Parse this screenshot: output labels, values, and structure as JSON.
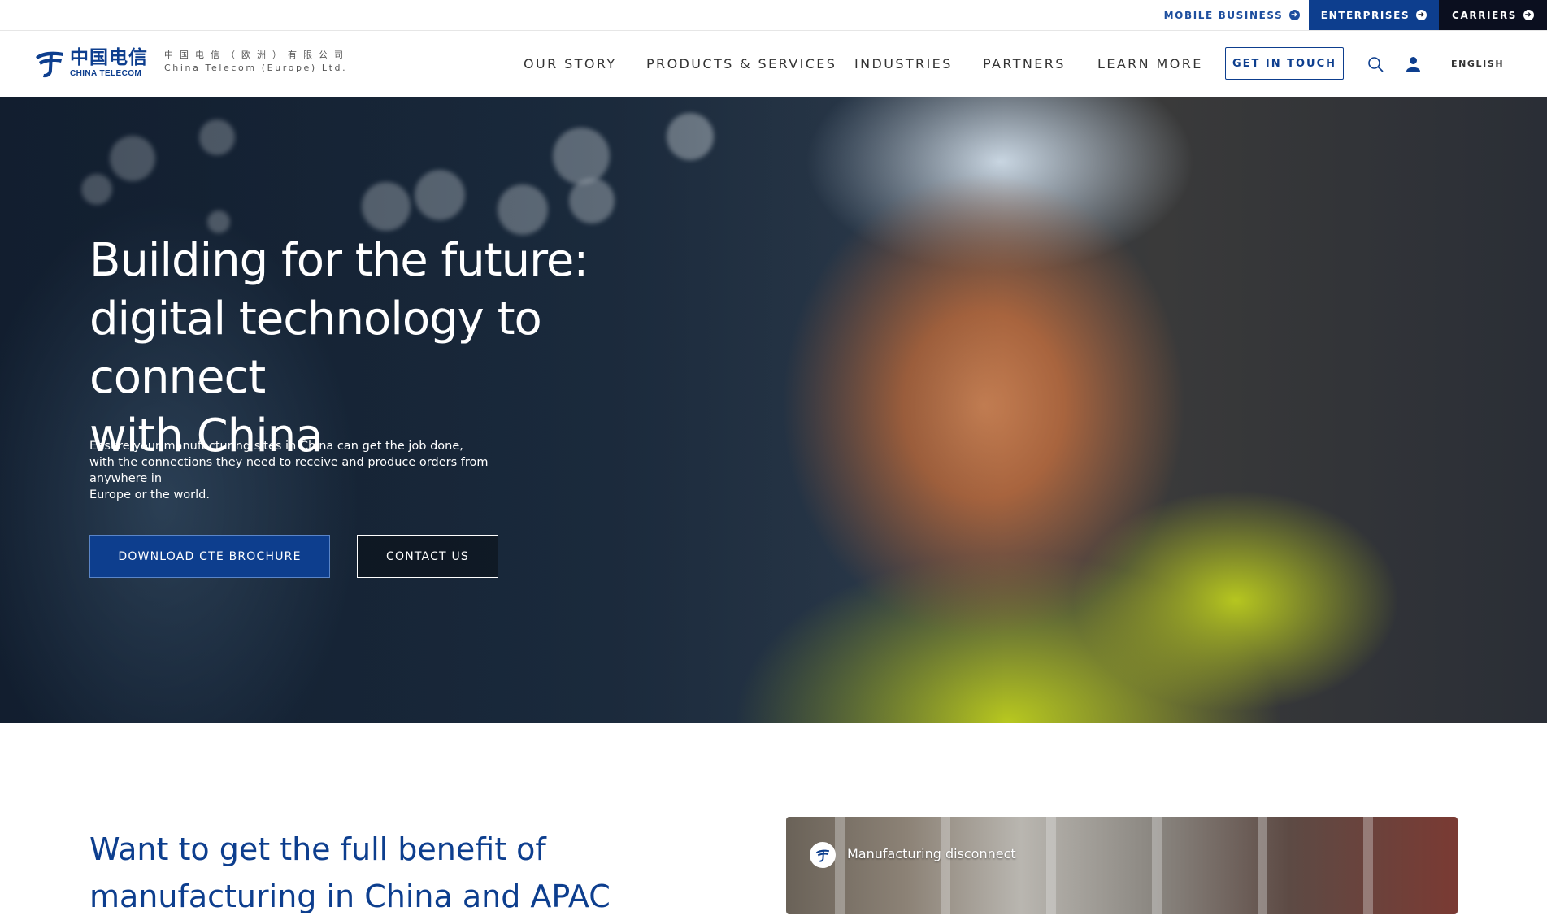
{
  "utility_bar": {
    "mobile_business": "MOBILE BUSINESS",
    "enterprises": "ENTERPRISES",
    "carriers": "CARRIERS"
  },
  "header": {
    "logo_chinese": "中国电信",
    "logo_english": "CHINA TELECOM",
    "logo_sub_chinese": "中国电信（欧洲）有限公司",
    "logo_sub_english": "China Telecom (Europe) Ltd.",
    "nav": [
      "OUR STORY",
      "PRODUCTS & SERVICES",
      "INDUSTRIES",
      "PARTNERS",
      "LEARN MORE"
    ],
    "cta_label": "GET IN TOUCH",
    "language": "ENGLISH"
  },
  "hero": {
    "title_line1": "Building for the future:",
    "title_line2": "digital technology to connect",
    "title_line3": "with China",
    "desc_line1": "Ensure your manufacturing sites in China can get the job done,",
    "desc_line2": "with the connections they need to receive and produce orders from anywhere in",
    "desc_line3": "Europe or the world.",
    "primary_button": "DOWNLOAD CTE BROCHURE",
    "secondary_button": "CONTACT US"
  },
  "section": {
    "heading_line1": "Want to get the full benefit of",
    "heading_line2": "manufacturing in China and APAC",
    "video_title": "Manufacturing disconnect"
  },
  "colors": {
    "brand_blue": "#0d3e8e",
    "carriers_bg": "#0b0f1f",
    "nav_text": "#333333"
  }
}
